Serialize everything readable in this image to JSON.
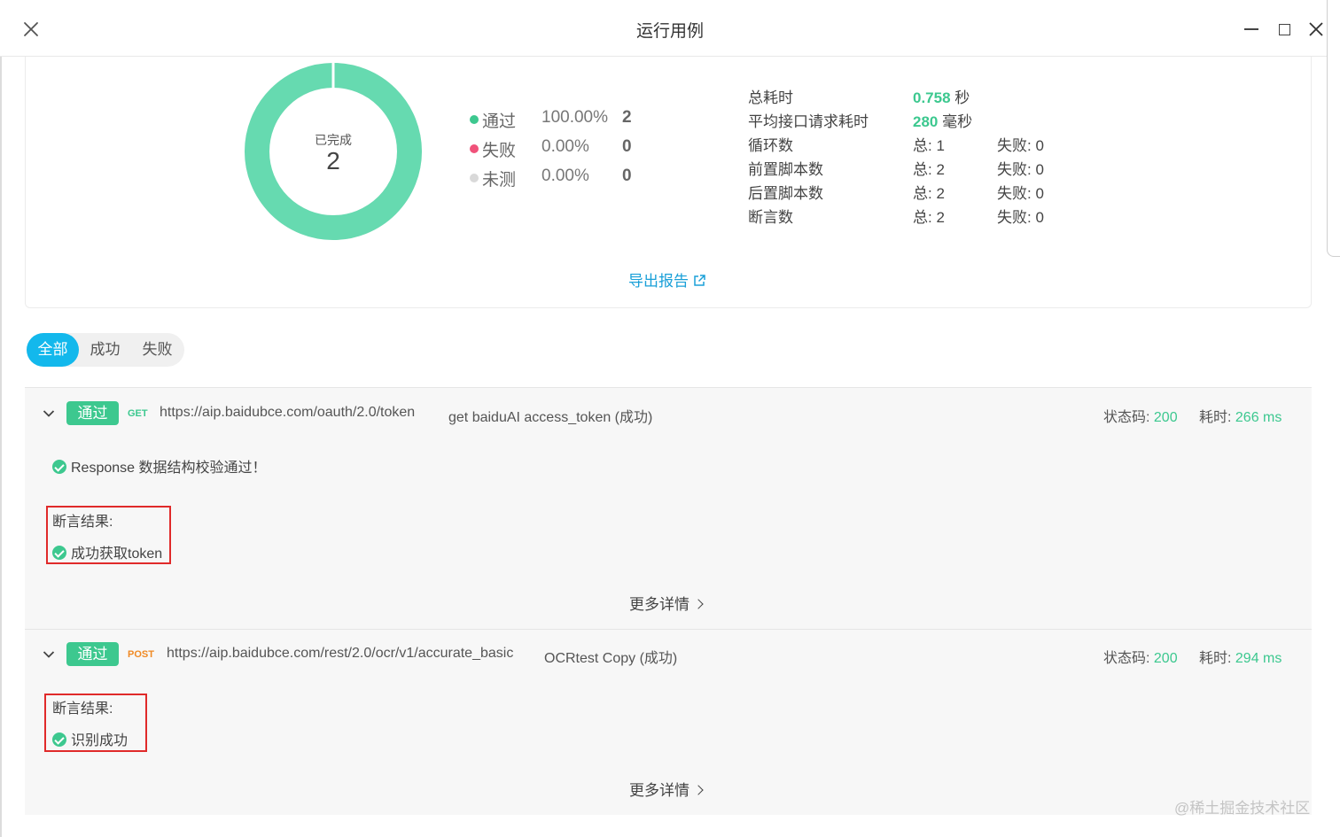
{
  "window": {
    "title": "运行用例"
  },
  "summary": {
    "donut": {
      "label": "已完成",
      "value": "2",
      "pass_fraction": 1.0,
      "color": "#66dab0"
    },
    "legend": [
      {
        "name": "通过",
        "percent": "100.00%",
        "count": "2",
        "color": "#3dc88f"
      },
      {
        "name": "失败",
        "percent": "0.00%",
        "count": "0",
        "color": "#f0527a"
      },
      {
        "name": "未测",
        "percent": "0.00%",
        "count": "0",
        "color": "#d9d9d9"
      }
    ],
    "stats": {
      "total_time_label": "总耗时",
      "total_time_value": "0.758",
      "total_time_unit": "秒",
      "avg_time_label": "平均接口请求耗时",
      "avg_time_value": "280",
      "avg_time_unit": "毫秒",
      "loop_label": "循环数",
      "loop_total": "总: 1",
      "loop_fail": "失败: 0",
      "pre_label": "前置脚本数",
      "pre_total": "总: 2",
      "pre_fail": "失败: 0",
      "post_label": "后置脚本数",
      "post_total": "总: 2",
      "post_fail": "失败: 0",
      "assert_label": "断言数",
      "assert_total": "总: 2",
      "assert_fail": "失败: 0"
    },
    "export_label": "导出报告"
  },
  "filter": {
    "tabs": [
      "全部",
      "成功",
      "失败"
    ],
    "active": "全部"
  },
  "results": [
    {
      "tag": "通过",
      "method": "GET",
      "method_color": "#3cc88f",
      "url": "https://aip.baidubce.com/oauth/2.0/token",
      "name": "get baiduAI access_token (成功)",
      "status_label": "状态码:",
      "status_value": "200",
      "time_label": "耗时:",
      "time_value": "266 ms",
      "schema_check": "Response 数据结构校验通过！",
      "assert_title": "断言结果:",
      "assert_item": "成功获取token",
      "more": "更多详情"
    },
    {
      "tag": "通过",
      "method": "POST",
      "method_color": "#f08a24",
      "url": "https://aip.baidubce.com/rest/2.0/ocr/v1/accurate_basic",
      "name": "OCRtest Copy (成功)",
      "status_label": "状态码:",
      "status_value": "200",
      "time_label": "耗时:",
      "time_value": "294 ms",
      "assert_title": "断言结果:",
      "assert_item": "识别成功",
      "more": "更多详情"
    }
  ],
  "watermark": "@稀土掘金技术社区"
}
